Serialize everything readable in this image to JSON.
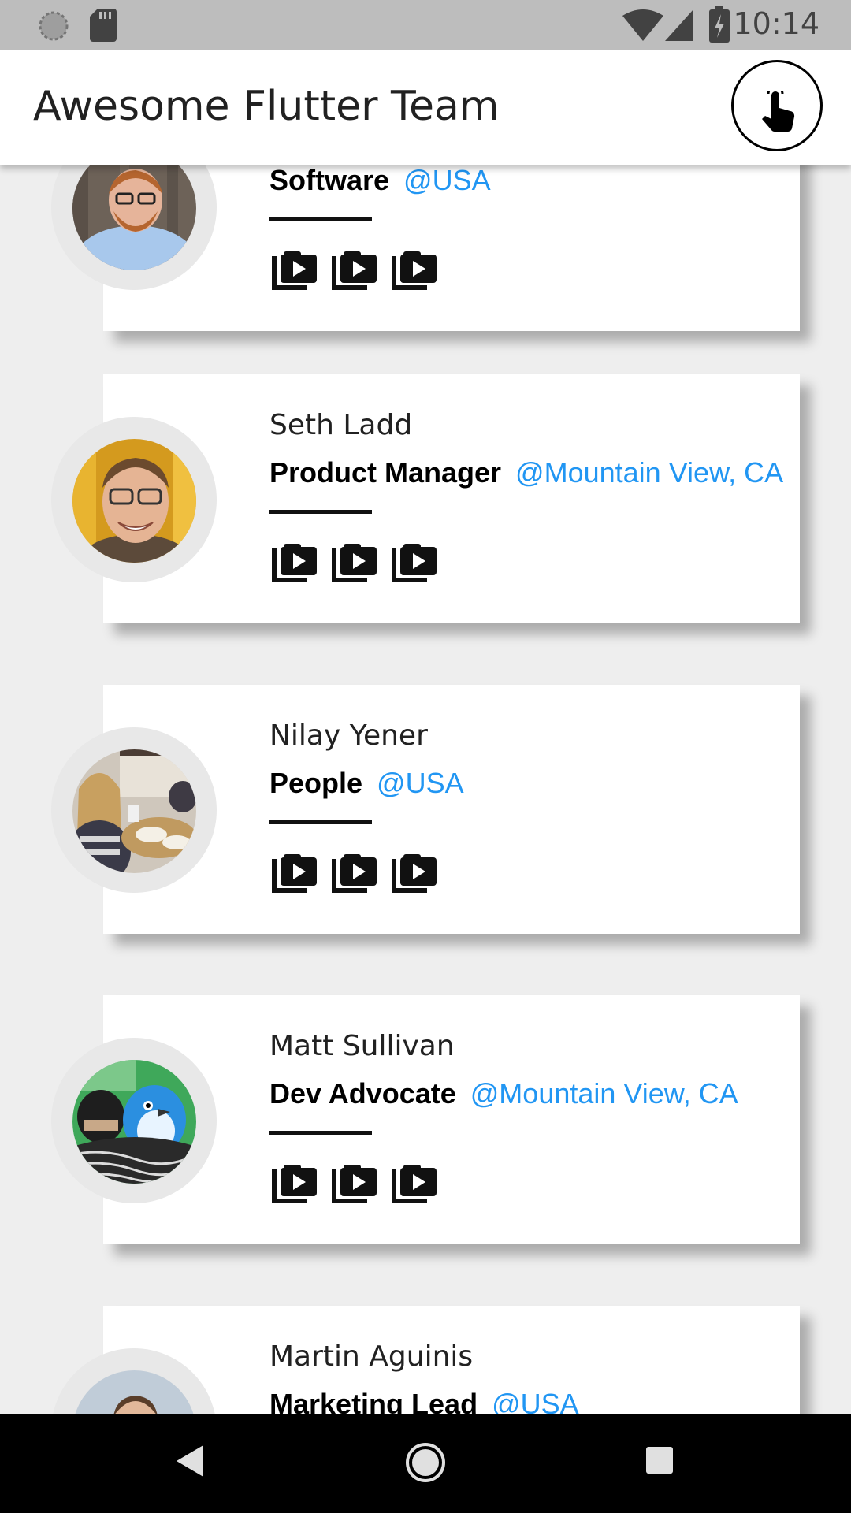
{
  "status_bar": {
    "time": "10:14",
    "icons": [
      "circle-notification-icon",
      "sd-card-icon",
      "wifi-icon",
      "cell-signal-icon",
      "battery-charging-icon"
    ]
  },
  "app_bar": {
    "title": "Awesome Flutter Team",
    "action_icon": "touch-app-icon"
  },
  "members": [
    {
      "name": "",
      "role": "Software",
      "location": "@USA"
    },
    {
      "name": "Seth Ladd",
      "role": "Product Manager",
      "location": "@Mountain View, CA"
    },
    {
      "name": "Nilay Yener",
      "role": "People",
      "location": "@USA"
    },
    {
      "name": "Matt Sullivan",
      "role": "Dev Advocate",
      "location": "@Mountain View, CA"
    },
    {
      "name": "Martin Aguinis",
      "role": "Marketing Lead",
      "location": "@USA"
    }
  ],
  "card_actions": [
    "video-library-icon",
    "video-library-icon",
    "video-library-icon"
  ],
  "nav_bar": {
    "icons": [
      "back-triangle-icon",
      "home-circle-icon",
      "recents-square-icon"
    ]
  },
  "colors": {
    "accent": "#2196f3",
    "background": "#eeeeee",
    "status_bar": "#bdbdbd",
    "nav_bar": "#000000"
  }
}
